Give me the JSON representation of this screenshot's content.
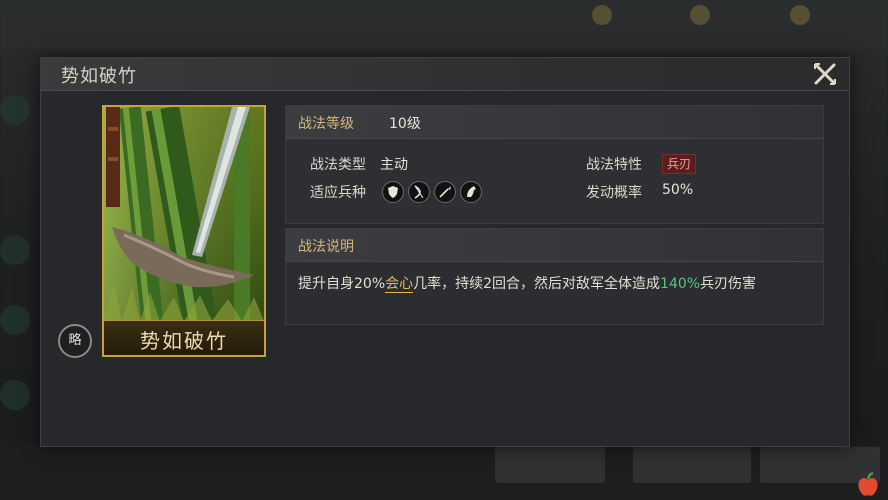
{
  "dialog": {
    "title": "势如破竹",
    "close_icon": "close-x-icon"
  },
  "card": {
    "name": "势如破竹",
    "tag_label": "略"
  },
  "info": {
    "level_label": "战法等级",
    "level_value": "10级",
    "type_label": "战法类型",
    "type_value": "主动",
    "trait_label": "战法特性",
    "trait_value": "兵刃",
    "units_label": "适应兵种",
    "units": [
      "shield-unit-icon",
      "bow-unit-icon",
      "spear-unit-icon",
      "cavalry-unit-icon"
    ],
    "chance_label": "发动概率",
    "chance_value": "50%"
  },
  "description": {
    "label": "战法说明",
    "part1": "提升自身20%",
    "hl1": "会心",
    "part2": "几率，持续2回合，然后对敌军全体造成",
    "hl2": "140%",
    "part3": "兵刃伤害"
  },
  "colors": {
    "accent_gold": "#d6b77a",
    "highlight_green": "#55c77a",
    "trait_red": "#5a1e1c",
    "card_border": "#c8a13b"
  }
}
